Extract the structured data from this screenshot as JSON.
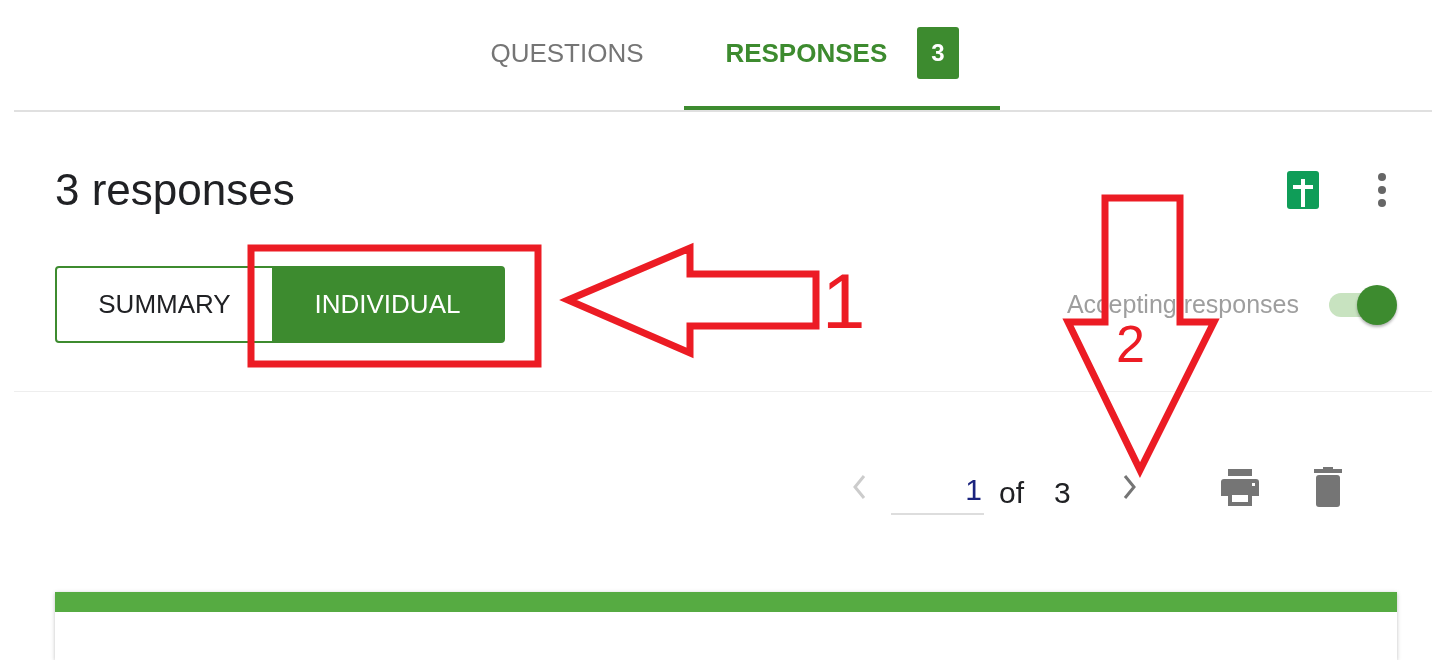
{
  "tabs": [
    {
      "label": "QUESTIONS",
      "selected": false
    },
    {
      "label": "RESPONSES",
      "selected": true,
      "badge": "3"
    }
  ],
  "heading": "3 responses",
  "view_toggle": [
    {
      "label": "SUMMARY",
      "selected": false
    },
    {
      "label": "INDIVIDUAL",
      "selected": true
    }
  ],
  "accepting_responses": {
    "label": "Accepting responses",
    "on": true
  },
  "pagination": {
    "current": "1",
    "of": "of",
    "total": "3"
  },
  "annotations": [
    {
      "label": "1"
    },
    {
      "label": "2"
    }
  ]
}
